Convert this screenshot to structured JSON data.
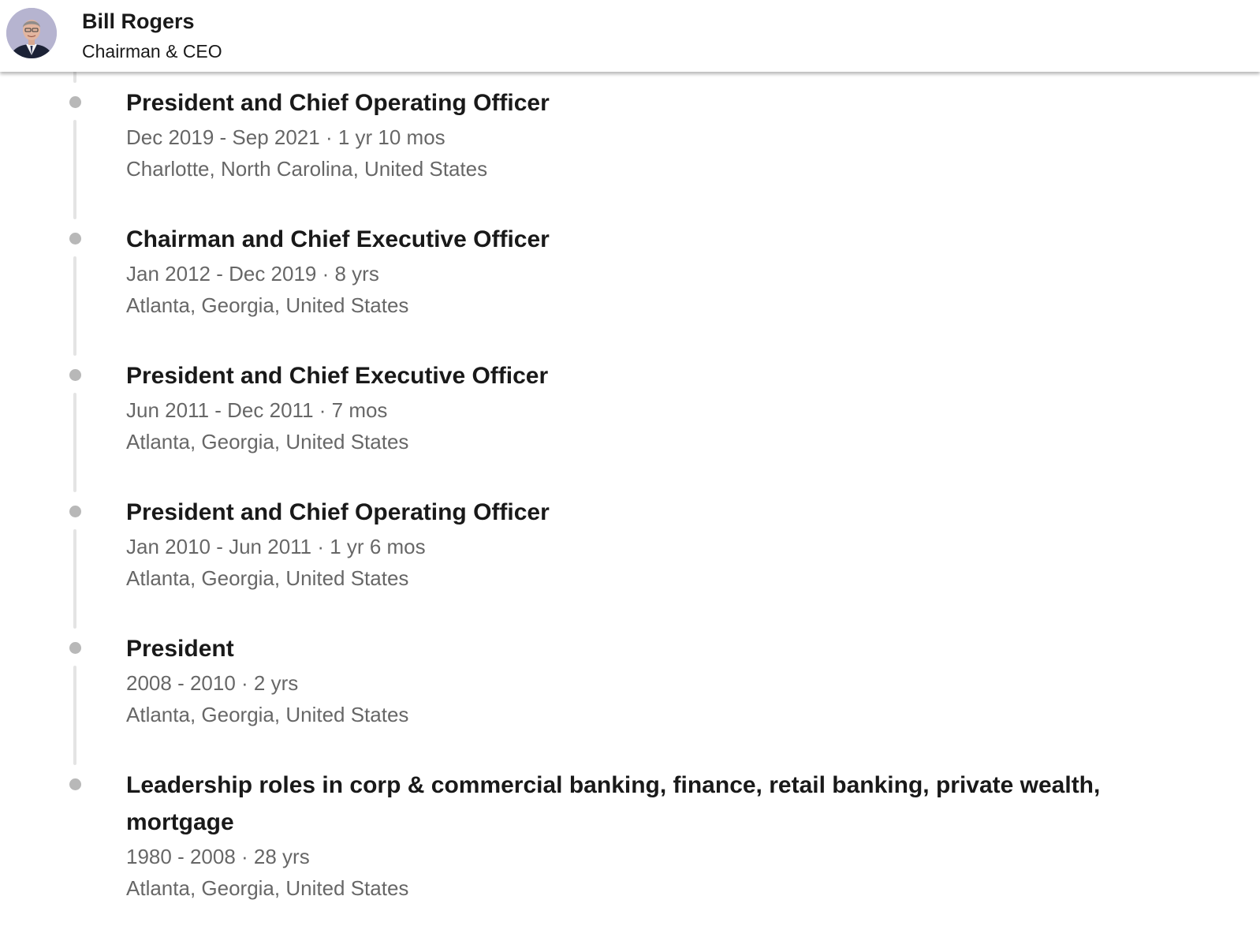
{
  "header": {
    "name": "Bill Rogers",
    "title": "Chairman & CEO"
  },
  "positions": [
    {
      "title": "President and Chief Operating Officer",
      "dates": "Dec 2019 - Sep 2021 · 1 yr 10 mos",
      "location": "Charlotte, North Carolina, United States"
    },
    {
      "title": "Chairman and Chief Executive Officer",
      "dates": "Jan 2012 - Dec 2019 · 8 yrs",
      "location": "Atlanta, Georgia, United States"
    },
    {
      "title": "President and Chief Executive Officer",
      "dates": "Jun 2011 - Dec 2011 · 7 mos",
      "location": "Atlanta, Georgia, United States"
    },
    {
      "title": "President and Chief Operating Officer",
      "dates": "Jan 2010 - Jun 2011 · 1 yr 6 mos",
      "location": "Atlanta, Georgia, United States"
    },
    {
      "title": "President",
      "dates": "2008 - 2010 · 2 yrs",
      "location": "Atlanta, Georgia, United States"
    },
    {
      "title": "Leadership roles in corp & commercial banking, finance, retail banking, private wealth, mortgage",
      "dates": "1980 - 2008 · 28 yrs",
      "location": "Atlanta, Georgia, United States"
    }
  ],
  "colors": {
    "timeline_dot": "#b8b8b8",
    "timeline_line": "#e4e4e4",
    "secondary_text": "#666666"
  }
}
